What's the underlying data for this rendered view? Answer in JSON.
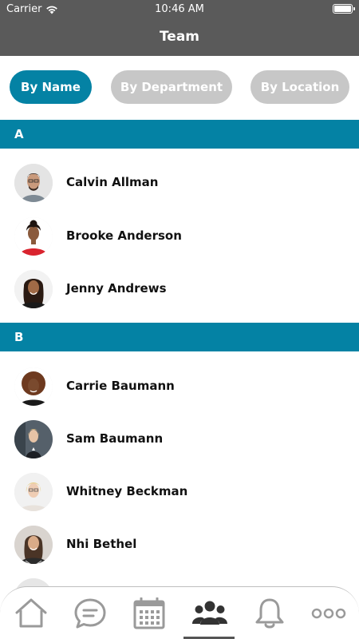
{
  "status_bar": {
    "carrier": "Carrier",
    "time": "10:46 AM"
  },
  "header": {
    "title": "Team"
  },
  "filters": {
    "by_name": "By Name",
    "by_department": "By Department",
    "by_location": "By Location",
    "active": "By Name"
  },
  "sections": [
    {
      "letter": "A",
      "people": [
        {
          "name": "Calvin Allman"
        },
        {
          "name": "Brooke Anderson"
        },
        {
          "name": "Jenny Andrews"
        }
      ]
    },
    {
      "letter": "B",
      "people": [
        {
          "name": "Carrie Baumann"
        },
        {
          "name": "Sam Baumann"
        },
        {
          "name": "Whitney Beckman"
        },
        {
          "name": "Nhi Bethel"
        }
      ]
    }
  ],
  "tab_bar": {
    "tabs": [
      "home-icon",
      "chat-icon",
      "calendar-icon",
      "team-icon",
      "bell-icon",
      "more-icon"
    ],
    "active_index": 3
  },
  "colors": {
    "accent": "#0482a4",
    "header_bg": "#5a5a5a",
    "inactive_pill": "#c7c7c7",
    "icon_gray": "#9a9a9a",
    "icon_active": "#333333"
  }
}
